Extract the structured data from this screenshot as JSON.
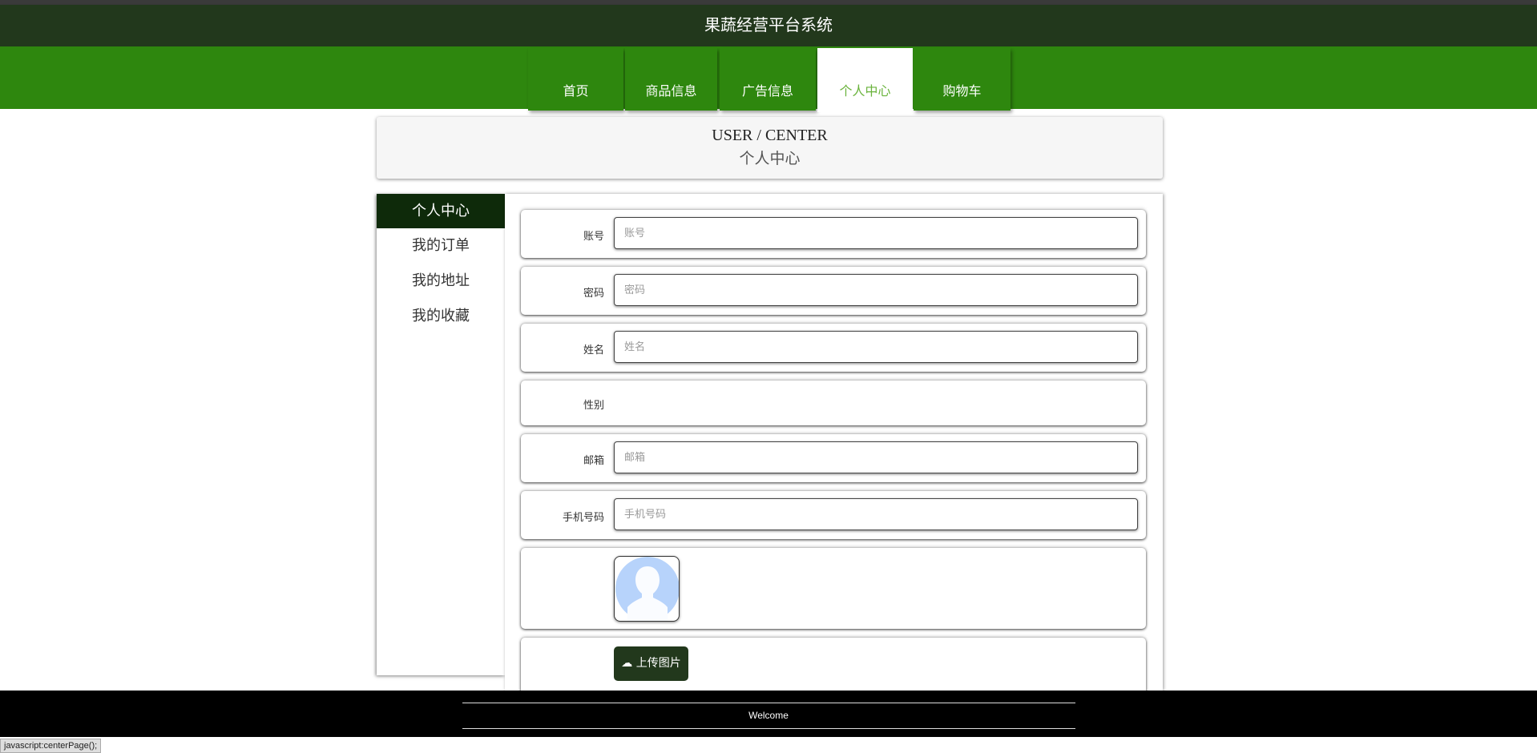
{
  "app_title": "果蔬经营平台系统",
  "nav": {
    "items": [
      {
        "label": "首页"
      },
      {
        "label": "商品信息"
      },
      {
        "label": "广告信息"
      },
      {
        "label": "个人中心",
        "active": true
      },
      {
        "label": "购物车"
      }
    ]
  },
  "header": {
    "en": "USER / CENTER",
    "cn": "个人中心"
  },
  "sidebar": {
    "items": [
      {
        "label": "个人中心",
        "active": true
      },
      {
        "label": "我的订单"
      },
      {
        "label": "我的地址"
      },
      {
        "label": "我的收藏"
      }
    ]
  },
  "form": {
    "account": {
      "label": "账号",
      "placeholder": "账号",
      "value": ""
    },
    "password": {
      "label": "密码",
      "placeholder": "密码",
      "value": ""
    },
    "name": {
      "label": "姓名",
      "placeholder": "姓名",
      "value": ""
    },
    "gender": {
      "label": "性别"
    },
    "email": {
      "label": "邮箱",
      "placeholder": "邮箱",
      "value": ""
    },
    "phone": {
      "label": "手机号码",
      "placeholder": "手机号码",
      "value": ""
    },
    "upload_label": "上传图片"
  },
  "footer": {
    "text": "Welcome"
  },
  "status_bar": "javascript:centerPage();",
  "colors": {
    "title_bar": "#22381c",
    "nav": "#2e870e",
    "active_text": "#6ab33c",
    "sidebar_active": "#0e2a0a"
  }
}
